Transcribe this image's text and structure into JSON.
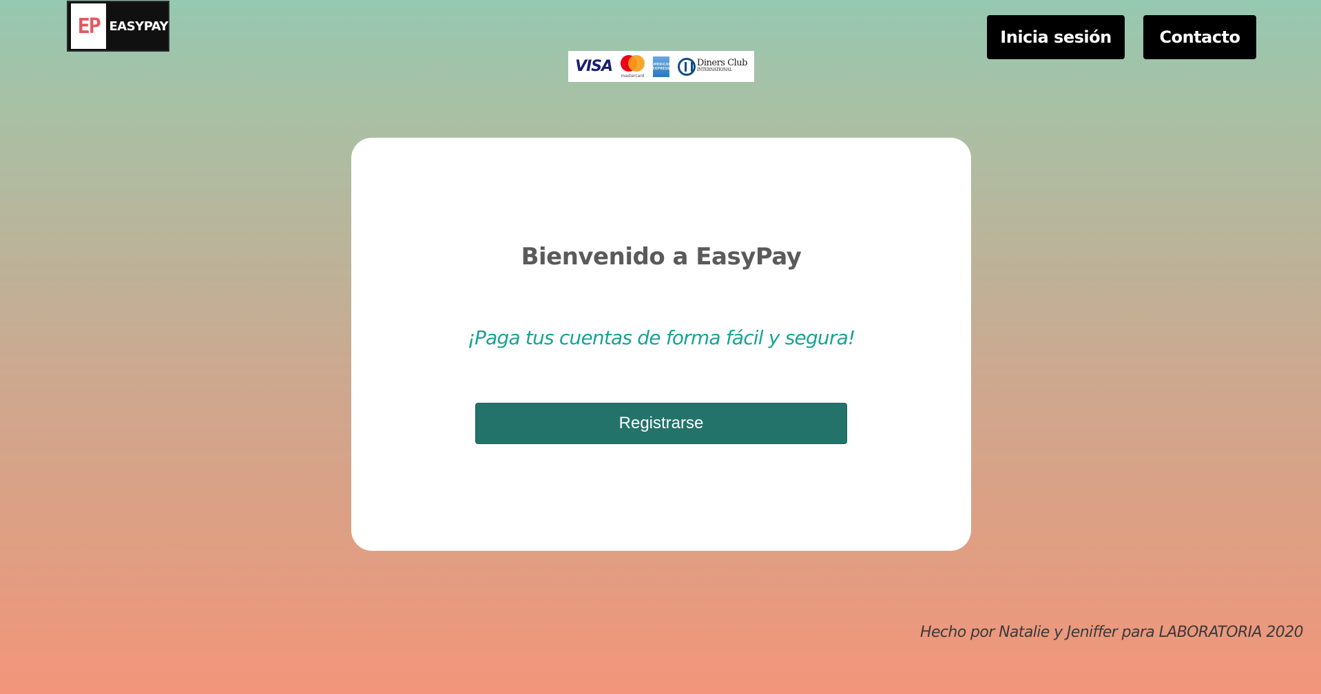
{
  "logo": {
    "mark": "EP",
    "wordmark": "EASYPAY"
  },
  "payment_brands": {
    "visa": "VISA",
    "mastercard": "mastercard",
    "amex": "AMERICAN EXPRESS",
    "diners_line1": "Diners Club",
    "diners_line2": "INTERNATIONAL"
  },
  "nav": {
    "login_label": "Inicia sesión",
    "contact_label": "Contacto"
  },
  "card": {
    "title": "Bienvenido a EasyPay",
    "subtitle": "¡Paga tus cuentas de forma fácil y segura!",
    "register_label": "Registrarse"
  },
  "footer": {
    "credit": "Hecho por Natalie y Jeniffer para LABORATORIA 2020"
  },
  "colors": {
    "gradient_top": "#96c8b2",
    "gradient_bottom": "#f3957a",
    "nav_button": "#000000",
    "primary_button": "#23736a",
    "subtitle_accent": "#17a294",
    "title_text": "#5a5a5a"
  }
}
